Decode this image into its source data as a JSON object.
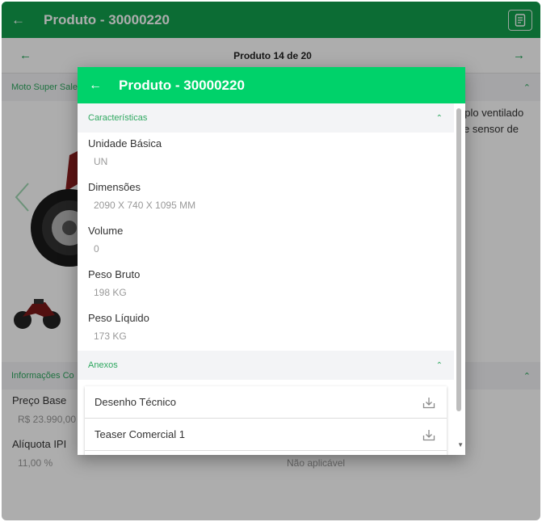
{
  "background": {
    "header_title": "Produto - 30000220",
    "pager_label": "Produto 14 de 20",
    "section_top_label": "Moto Super Sale",
    "description_fragment_1": "uplo ventilado",
    "description_fragment_2": "e sensor de",
    "section_info_label": "Informações Co",
    "preco_label": "Preço Base",
    "preco_value": "R$ 23.990,00",
    "ipi_label": "Alíquota IPI",
    "ipi_value": "11,00 %",
    "nao_aplicavel": "Não aplicável"
  },
  "modal": {
    "title": "Produto - 30000220",
    "characteristics": {
      "section_label": "Características",
      "fields": [
        {
          "label": "Unidade Básica",
          "value": "UN"
        },
        {
          "label": "Dimensões",
          "value": "2090 X 740 X 1095 MM"
        },
        {
          "label": "Volume",
          "value": "0"
        },
        {
          "label": "Peso Bruto",
          "value": "198 KG"
        },
        {
          "label": "Peso Líquido",
          "value": "173 KG"
        }
      ]
    },
    "attachments": {
      "section_label": "Anexos",
      "items": [
        "Desenho Técnico",
        "Teaser Comercial 1"
      ]
    }
  },
  "colors": {
    "app_header": "#12a04d",
    "modal_header": "#00d26a",
    "section_text": "#2fa860"
  },
  "icons": [
    "back-arrow-icon",
    "document-icon",
    "chevron-up-icon",
    "download-icon"
  ]
}
